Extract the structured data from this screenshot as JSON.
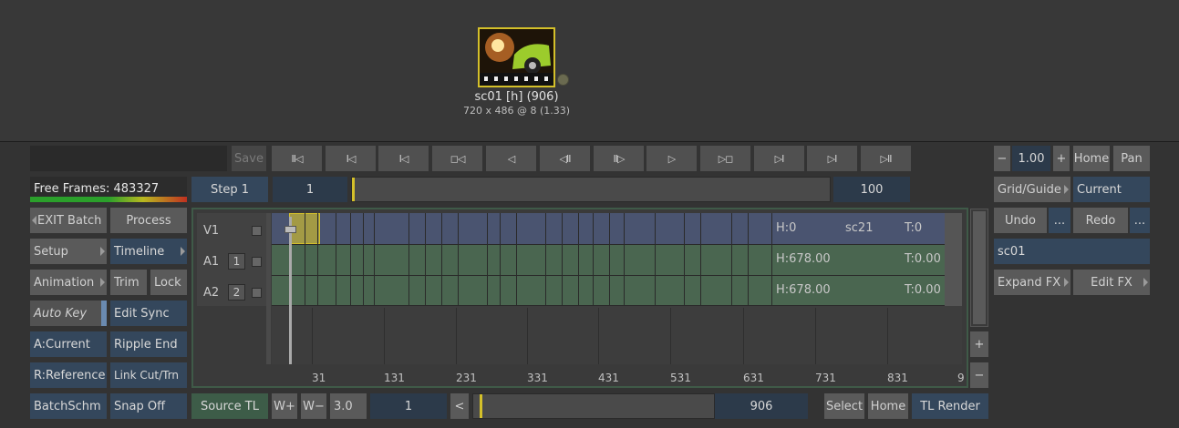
{
  "node": {
    "name": "sc01 [h] (906)",
    "info": "720 x 486 @ 8 (1.33)"
  },
  "toolbar": {
    "save_label": "Save",
    "step_label": "Step 1",
    "start_frame": "1",
    "end_frame": "100"
  },
  "playback": {
    "buttons": [
      "II◁",
      "I◁",
      "I◁",
      "◻◁",
      "◁",
      "◁II",
      "II▷",
      "▷",
      "▷◻",
      "▷I",
      "▷I",
      "▷II"
    ]
  },
  "free_frames": {
    "label": "Free Frames: 483327",
    "fill_fraction": 0.62
  },
  "left_menu": {
    "exit_batch": "EXIT Batch",
    "process": "Process",
    "setup": "Setup",
    "timeline": "Timeline",
    "animation": "Animation",
    "trim": "Trim",
    "lock": "Lock",
    "auto_key": "Auto Key",
    "edit_sync": "Edit Sync",
    "a_current": "A:Current",
    "ripple_end": "Ripple End",
    "r_reference": "R:Reference",
    "link_cut": "Link Cut/Trn",
    "batch_schm": "BatchSchm",
    "snap_off": "Snap Off"
  },
  "tracks": {
    "v1": {
      "label": "V1",
      "h": "H:0",
      "name": "sc21",
      "t": "T:0"
    },
    "a1": {
      "label": "A1",
      "num": "1",
      "h": "H:678.00",
      "t": "T:0.00"
    },
    "a2": {
      "label": "A2",
      "num": "2",
      "h": "H:678.00",
      "t": "T:0.00"
    }
  },
  "ruler": {
    "ticks": [
      "31",
      "131",
      "231",
      "331",
      "431",
      "531",
      "631",
      "731",
      "831",
      "9"
    ]
  },
  "bottom": {
    "source_tl": "Source TL",
    "w_plus": "W+",
    "w_minus": "W−",
    "speed": "3.0",
    "frame": "1",
    "back": "<",
    "end": "906",
    "select": "Select",
    "home": "Home",
    "tl_render": "TL Render"
  },
  "right": {
    "minus": "−",
    "zoom": "1.00",
    "plus": "+",
    "home": "Home",
    "pan": "Pan",
    "grid_guide": "Grid/Guide",
    "current": "Current",
    "undo": "Undo",
    "redo": "Redo",
    "dots": "...",
    "clip_name": "sc01",
    "expand_fx": "Expand FX",
    "edit_fx": "Edit FX"
  },
  "colors": {
    "accent_yellow": "#d4c02a",
    "video_track": "#4a5470",
    "audio_track": "#4a6650",
    "blue_field": "#34475c"
  }
}
